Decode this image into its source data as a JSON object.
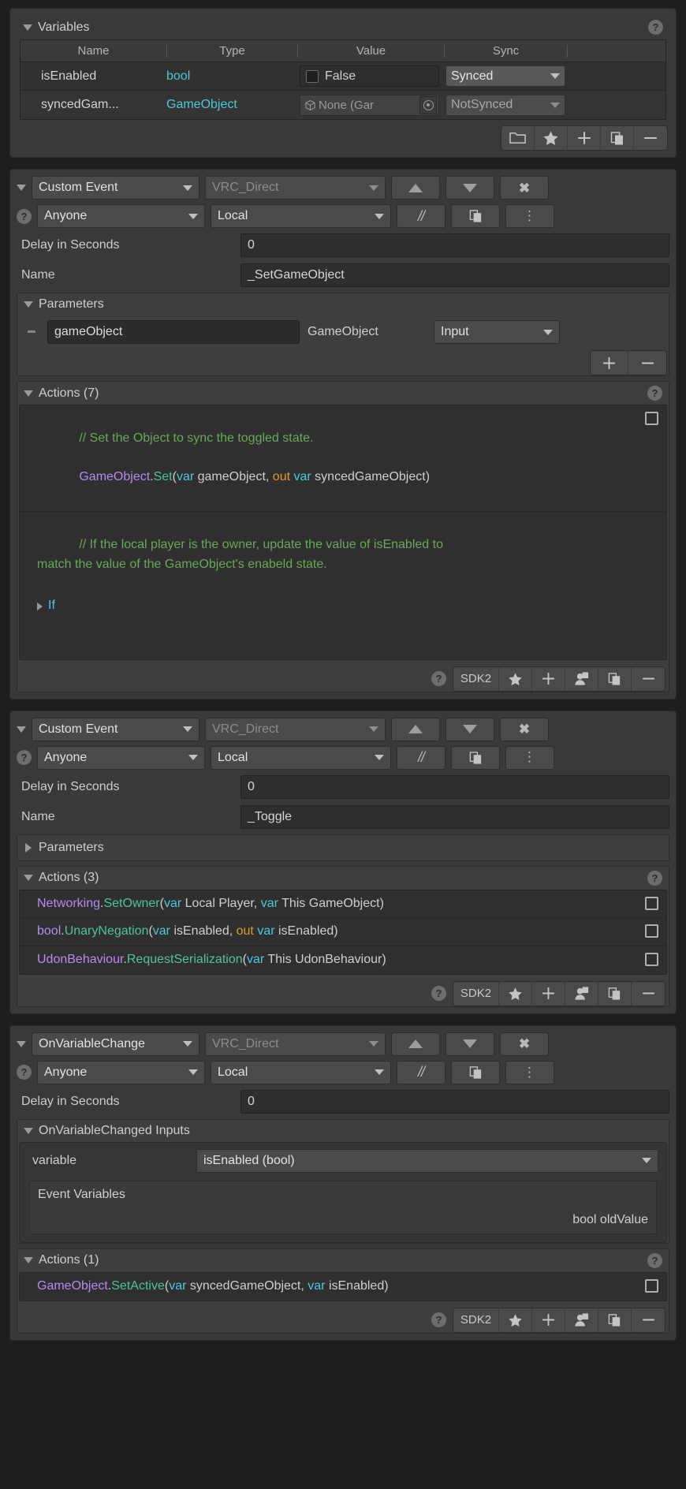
{
  "variables_panel": {
    "title": "Variables",
    "help_icon": "?",
    "columns": [
      "Name",
      "Type",
      "Value",
      "Sync"
    ],
    "rows": [
      {
        "name": "isEnabled",
        "type": "bool",
        "value": "False",
        "value_kind": "checkbox",
        "checked": false,
        "sync": "Synced"
      },
      {
        "name": "syncedGam...",
        "type": "GameObject",
        "value": "None (Gar",
        "value_kind": "object",
        "sync": "NotSynced"
      }
    ],
    "toolbar": [
      {
        "icon": "folder-icon",
        "label": ""
      },
      {
        "icon": "star-icon",
        "label": ""
      },
      {
        "icon": "plus-icon",
        "label": "+"
      },
      {
        "icon": "duplicate-icon",
        "label": ""
      },
      {
        "icon": "minus-icon",
        "label": "−"
      }
    ]
  },
  "nodes": [
    {
      "id": "set-gameobject",
      "event_type": "Custom Event",
      "network_type": "VRC_Direct",
      "move_up_icon": "arrow-up-icon",
      "move_down_icon": "arrow-down-icon",
      "delete_icon": "close-icon",
      "access": "Anyone",
      "target": "Local",
      "comment_icon": "//",
      "copy_icon": "duplicate-icon",
      "menu_icon": "kebab-menu-icon",
      "delay_label": "Delay in Seconds",
      "delay_value": "0",
      "name_label": "Name",
      "name_value": "_SetGameObject",
      "parameters": {
        "title": "Parameters",
        "expanded": true,
        "rows": [
          {
            "name": "gameObject",
            "type": "GameObject",
            "direction": "Input"
          }
        ],
        "add_label": "+",
        "remove_label": "−"
      },
      "actions": {
        "title": "Actions (7)",
        "help_icon": "?",
        "lines": [
          {
            "kind": "code",
            "tokens": [
              {
                "t": "// Set the Object to sync the toggled state.\n",
                "c": "comment"
              },
              {
                "t": "GameObject",
                "c": "kw-type"
              },
              {
                "t": ".",
                "c": "plain"
              },
              {
                "t": "Set",
                "c": "kw-fn"
              },
              {
                "t": "(",
                "c": "plain"
              },
              {
                "t": "var",
                "c": "kw-var"
              },
              {
                "t": " gameObject, ",
                "c": "plain"
              },
              {
                "t": "out",
                "c": "kw-out"
              },
              {
                "t": " ",
                "c": "plain"
              },
              {
                "t": "var",
                "c": "kw-var"
              },
              {
                "t": " syncedGameObject)",
                "c": "plain"
              }
            ],
            "has_box": true
          },
          {
            "kind": "code-if",
            "tokens": [
              {
                "t": "// If the local player is the owner, update the value of isEnabled to\nmatch the value of the GameObject's enabeld state.",
                "c": "comment"
              }
            ],
            "if_label": "If",
            "has_box": false
          }
        ],
        "footer": [
          "?",
          "SDK2",
          "star-icon",
          "plus-icon",
          "person-icon",
          "duplicate-icon",
          "minus-icon"
        ],
        "footer_sdk_label": "SDK2"
      }
    },
    {
      "id": "toggle",
      "event_type": "Custom Event",
      "network_type": "VRC_Direct",
      "access": "Anyone",
      "target": "Local",
      "comment_icon": "//",
      "delay_label": "Delay in Seconds",
      "delay_value": "0",
      "name_label": "Name",
      "name_value": "_Toggle",
      "parameters": {
        "title": "Parameters",
        "expanded": false,
        "rows": []
      },
      "actions": {
        "title": "Actions (3)",
        "help_icon": "?",
        "lines": [
          {
            "kind": "code",
            "tokens": [
              {
                "t": "Networking",
                "c": "kw-type"
              },
              {
                "t": ".",
                "c": "plain"
              },
              {
                "t": "SetOwner",
                "c": "kw-fn"
              },
              {
                "t": "(",
                "c": "plain"
              },
              {
                "t": "var",
                "c": "kw-var"
              },
              {
                "t": " Local Player, ",
                "c": "plain"
              },
              {
                "t": "var",
                "c": "kw-var"
              },
              {
                "t": " This GameObject)",
                "c": "plain"
              }
            ],
            "has_box": true
          },
          {
            "kind": "code",
            "tokens": [
              {
                "t": "bool",
                "c": "kw-type"
              },
              {
                "t": ".",
                "c": "plain"
              },
              {
                "t": "UnaryNegation",
                "c": "kw-fn"
              },
              {
                "t": "(",
                "c": "plain"
              },
              {
                "t": "var",
                "c": "kw-var"
              },
              {
                "t": " isEnabled, ",
                "c": "plain"
              },
              {
                "t": "out",
                "c": "kw-out"
              },
              {
                "t": " ",
                "c": "plain"
              },
              {
                "t": "var",
                "c": "kw-var"
              },
              {
                "t": " isEnabled)",
                "c": "plain"
              }
            ],
            "has_box": true
          },
          {
            "kind": "code",
            "tokens": [
              {
                "t": "UdonBehaviour",
                "c": "kw-type"
              },
              {
                "t": ".",
                "c": "plain"
              },
              {
                "t": "RequestSerialization",
                "c": "kw-fn"
              },
              {
                "t": "(",
                "c": "plain"
              },
              {
                "t": "var",
                "c": "kw-var"
              },
              {
                "t": " This UdonBehaviour)",
                "c": "plain"
              }
            ],
            "has_box": true
          }
        ],
        "footer_sdk_label": "SDK2"
      }
    },
    {
      "id": "on-variable-changed",
      "event_type": "OnVariableChange",
      "network_type": "VRC_Direct",
      "access": "Anyone",
      "target": "Local",
      "comment_icon": "//",
      "delay_label": "Delay in Seconds",
      "delay_value": "0",
      "inputs": {
        "title": "OnVariableChanged Inputs",
        "variable_label": "variable",
        "variable_value": "isEnabled (bool)",
        "event_variables_title": "Event Variables",
        "event_variables_value": "bool oldValue"
      },
      "actions": {
        "title": "Actions (1)",
        "help_icon": "?",
        "lines": [
          {
            "kind": "code",
            "tokens": [
              {
                "t": "GameObject",
                "c": "kw-type"
              },
              {
                "t": ".",
                "c": "plain"
              },
              {
                "t": "SetActive",
                "c": "kw-fn"
              },
              {
                "t": "(",
                "c": "plain"
              },
              {
                "t": "var",
                "c": "kw-var"
              },
              {
                "t": " syncedGameObject, ",
                "c": "plain"
              },
              {
                "t": "var",
                "c": "kw-var"
              },
              {
                "t": " isEnabled)",
                "c": "plain"
              }
            ],
            "has_box": true
          }
        ],
        "footer_sdk_label": "SDK2"
      }
    }
  ],
  "colors": {
    "panel_bg": "#393939",
    "page_bg": "#1e1e1e",
    "comment_green": "#69a95a",
    "type_purple": "#b58cf0",
    "fn_teal": "#4ec49b",
    "var_cyan": "#4ec9d6",
    "out_orange": "#e09a2b"
  }
}
